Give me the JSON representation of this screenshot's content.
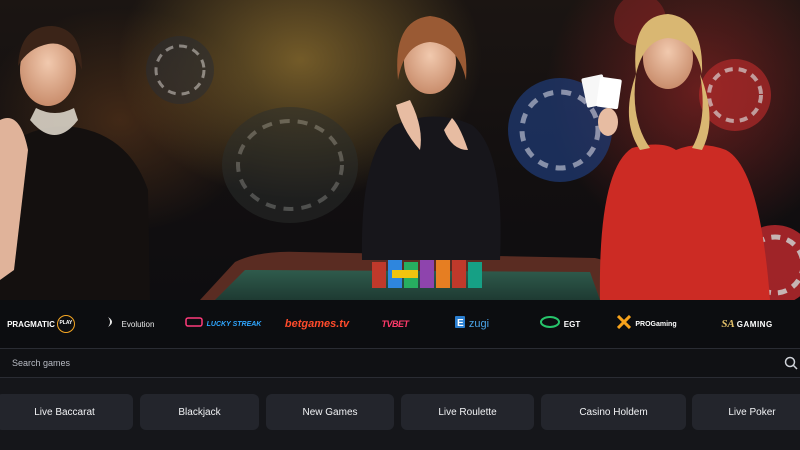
{
  "providers": [
    {
      "name": "PRAGMATIC",
      "suffix": "PLAY",
      "icon": "pragmatic-play-logo-icon",
      "color": "#ffffff",
      "accent": "#f5a623"
    },
    {
      "name": "Evolution",
      "icon": "evolution-logo-icon",
      "color": "#e8e8e8"
    },
    {
      "name": "LUCKY STREAK",
      "icon": "lucky-streak-logo-icon",
      "color": "#2fa6ff"
    },
    {
      "name": "betgames.tv",
      "icon": "betgames-logo-icon",
      "color": "#ff4b2b"
    },
    {
      "name": "TVBET",
      "icon": "tvbet-logo-icon",
      "color": "#ff3a6a"
    },
    {
      "name": "zugi",
      "icon": "ezugi-logo-icon",
      "color": "#4aa3e6"
    },
    {
      "name": "EGT",
      "icon": "egt-logo-icon",
      "color": "#ffffff",
      "accent": "#27c46b"
    },
    {
      "name": "PROGaming",
      "icon": "progaming-logo-icon",
      "color": "#ffffff",
      "accent": "#f7a21b"
    },
    {
      "name": "GAMING",
      "prefix": "SA",
      "icon": "sa-gaming-logo-icon",
      "color": "#ffffff"
    }
  ],
  "search": {
    "placeholder": "Search games",
    "icon": "search-icon"
  },
  "categories": [
    {
      "label": "Live Baccarat"
    },
    {
      "label": "Blackjack"
    },
    {
      "label": "New Games"
    },
    {
      "label": "Live Roulette"
    },
    {
      "label": "Casino Holdem"
    },
    {
      "label": "Live Poker"
    }
  ]
}
